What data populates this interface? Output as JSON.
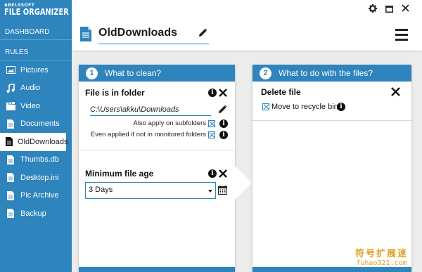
{
  "app": {
    "logo_small": "ABELSSOFT",
    "logo_big": "FILE ORGANIZER"
  },
  "sidebar": {
    "dashboard_label": "DASHBOARD",
    "rules_label": "RULES",
    "items": [
      {
        "label": "Pictures",
        "icon": "image-icon"
      },
      {
        "label": "Audio",
        "icon": "music-note-icon"
      },
      {
        "label": "Video",
        "icon": "clapperboard-icon"
      },
      {
        "label": "Documents",
        "icon": "document-icon"
      },
      {
        "label": "OldDownloads",
        "icon": "document-icon",
        "active": true
      },
      {
        "label": "Thumbs.db",
        "icon": "document-icon"
      },
      {
        "label": "Desktop.ini",
        "icon": "document-icon"
      },
      {
        "label": "Pic Archive",
        "icon": "document-icon"
      },
      {
        "label": "Backup",
        "icon": "document-icon"
      }
    ]
  },
  "header": {
    "rule_name": "OldDownloads"
  },
  "conditions_panel": {
    "step": "1",
    "title": "What to clean?",
    "folder": {
      "title": "File is in folder",
      "path": "C:\\Users\\akku\\Downloads",
      "opt_subfolders": "Also apply on subfolders",
      "opt_monitored": "Even applied if not in monitored folders"
    },
    "age": {
      "title": "Minimum file age",
      "value": "3 Days"
    }
  },
  "actions_panel": {
    "step": "2",
    "title": "What to do with the files?",
    "action_title": "Delete file",
    "option_recycle": "Move to recycle bin"
  },
  "watermark": {
    "cn": "符号扩展迷",
    "url": "fuhao321.com"
  },
  "colors": {
    "accent": "#2e84bd",
    "background": "#ececec"
  }
}
